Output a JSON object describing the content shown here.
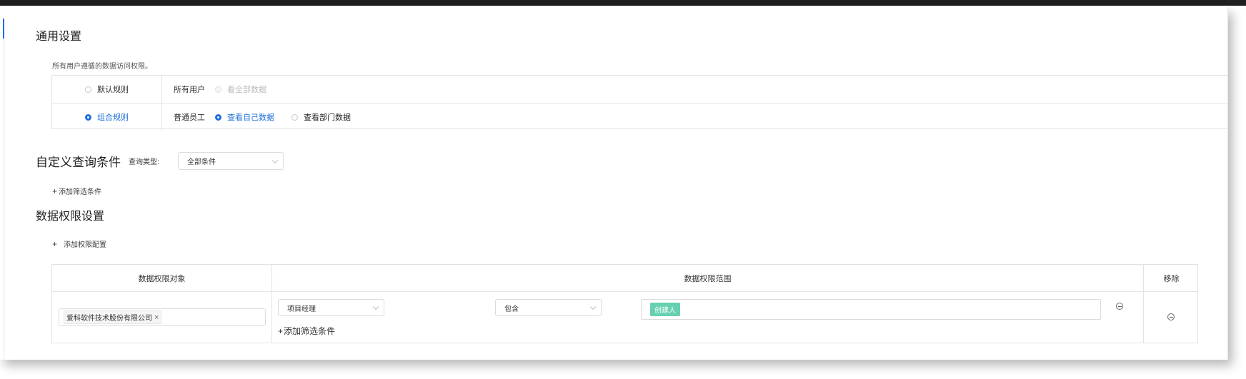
{
  "general": {
    "title": "通用设置",
    "description": "所有用户遵循的数据访问权限。",
    "rows": [
      {
        "rule": "默认规则",
        "rule_selected": false,
        "target": "所有用户",
        "options": [
          {
            "label": "看全部数据",
            "state": "disabled"
          }
        ]
      },
      {
        "rule": "组合规则",
        "rule_selected": true,
        "target": "普通员工",
        "options": [
          {
            "label": "查看自己数据",
            "state": "checked"
          },
          {
            "label": "查看部门数据",
            "state": "unchecked"
          }
        ]
      }
    ]
  },
  "custom_query": {
    "title": "自定义查询条件",
    "type_label": "查询类型:",
    "type_value": "全部条件",
    "add_label": "添加筛选条件"
  },
  "permission": {
    "title": "数据权限设置",
    "add_label": "添加权限配置",
    "headers": [
      "数据权限对象",
      "数据权限范围",
      "移除"
    ],
    "row": {
      "object_tag": "爱科软件技术股份有限公司",
      "field": "项目经理",
      "operator": "包含",
      "value_tag": "创建人",
      "add_label": "添加筛选条件"
    }
  },
  "colors": {
    "accent": "#1d6fdc",
    "value_tag": "#66d0b0"
  }
}
